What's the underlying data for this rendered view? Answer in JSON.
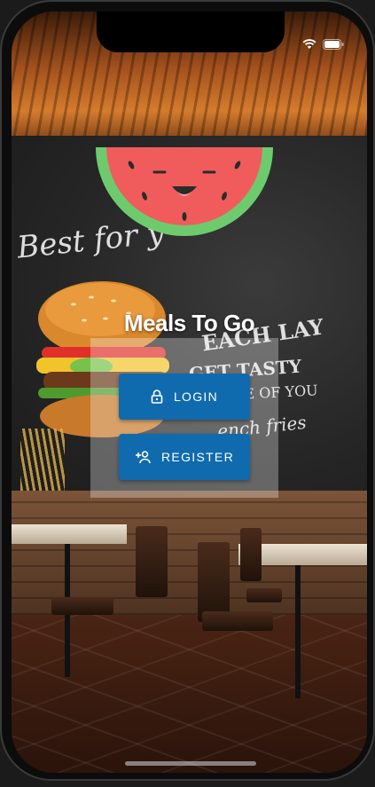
{
  "app": {
    "title": "Meals To Go"
  },
  "background": {
    "chalk_lines": [
      "Best for y",
      "EACH LAY",
      "GET TASTY",
      "USE OF YOU",
      "ench fries"
    ]
  },
  "auth": {
    "login_label": "LOGIN",
    "register_label": "REGISTER"
  },
  "icons": {
    "login": "lock-icon",
    "register": "add-user-icon",
    "logo": "watermelon-icon"
  },
  "colors": {
    "button": "#0F6BAD",
    "button_text": "#FFFFFF",
    "card_overlay": "rgba(255,255,255,0.30)",
    "watermelon_flesh": "#F05C5C",
    "watermelon_rind": "#6DCB6D"
  }
}
